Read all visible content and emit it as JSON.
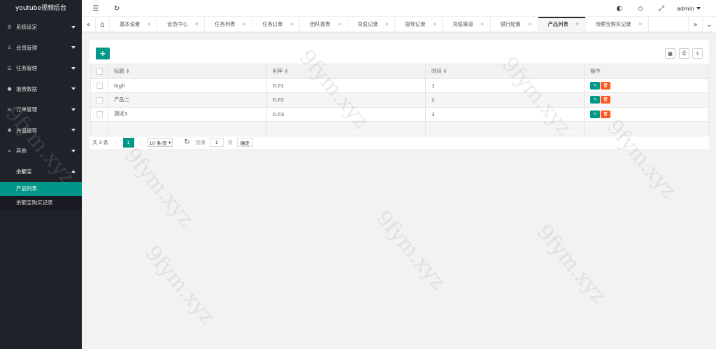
{
  "app": {
    "title": "youtube视频后台"
  },
  "header": {
    "user": "admin"
  },
  "sidebar": {
    "items": [
      {
        "label": "系统设定"
      },
      {
        "label": "会员管理"
      },
      {
        "label": "任务管理"
      },
      {
        "label": "报表数据"
      },
      {
        "label": "订单管理"
      },
      {
        "label": "充值提现"
      },
      {
        "label": "其他"
      },
      {
        "label": "余额宝"
      }
    ],
    "submenu": [
      {
        "label": "产品列表"
      },
      {
        "label": "余额宝购买记录"
      }
    ]
  },
  "tabs": [
    {
      "label": "基本设置"
    },
    {
      "label": "会员中心"
    },
    {
      "label": "任务列表"
    },
    {
      "label": "任务订单"
    },
    {
      "label": "团队报表"
    },
    {
      "label": "充值记录"
    },
    {
      "label": "提现记录"
    },
    {
      "label": "充值渠道"
    },
    {
      "label": "银行配置"
    },
    {
      "label": "产品列表"
    },
    {
      "label": "余额宝购买记录"
    }
  ],
  "table": {
    "columns": [
      "标题",
      "利率",
      "时间",
      "操作"
    ],
    "rows": [
      {
        "title": "high",
        "rate": "0.01",
        "time": "1"
      },
      {
        "title": "产品二",
        "rate": "0.02",
        "time": "2"
      },
      {
        "title": "测试3",
        "rate": "0.03",
        "time": "3"
      }
    ]
  },
  "pager": {
    "total": "共 3 条",
    "current": "1",
    "page_size": "10 条/页",
    "goto_label": "到第",
    "goto_value": "1",
    "page_unit": "页",
    "confirm": "确定"
  },
  "watermark": "9fym.xyz",
  "colors": {
    "accent": "#009688",
    "danger": "#ff5722",
    "sidebar": "#20222a"
  }
}
